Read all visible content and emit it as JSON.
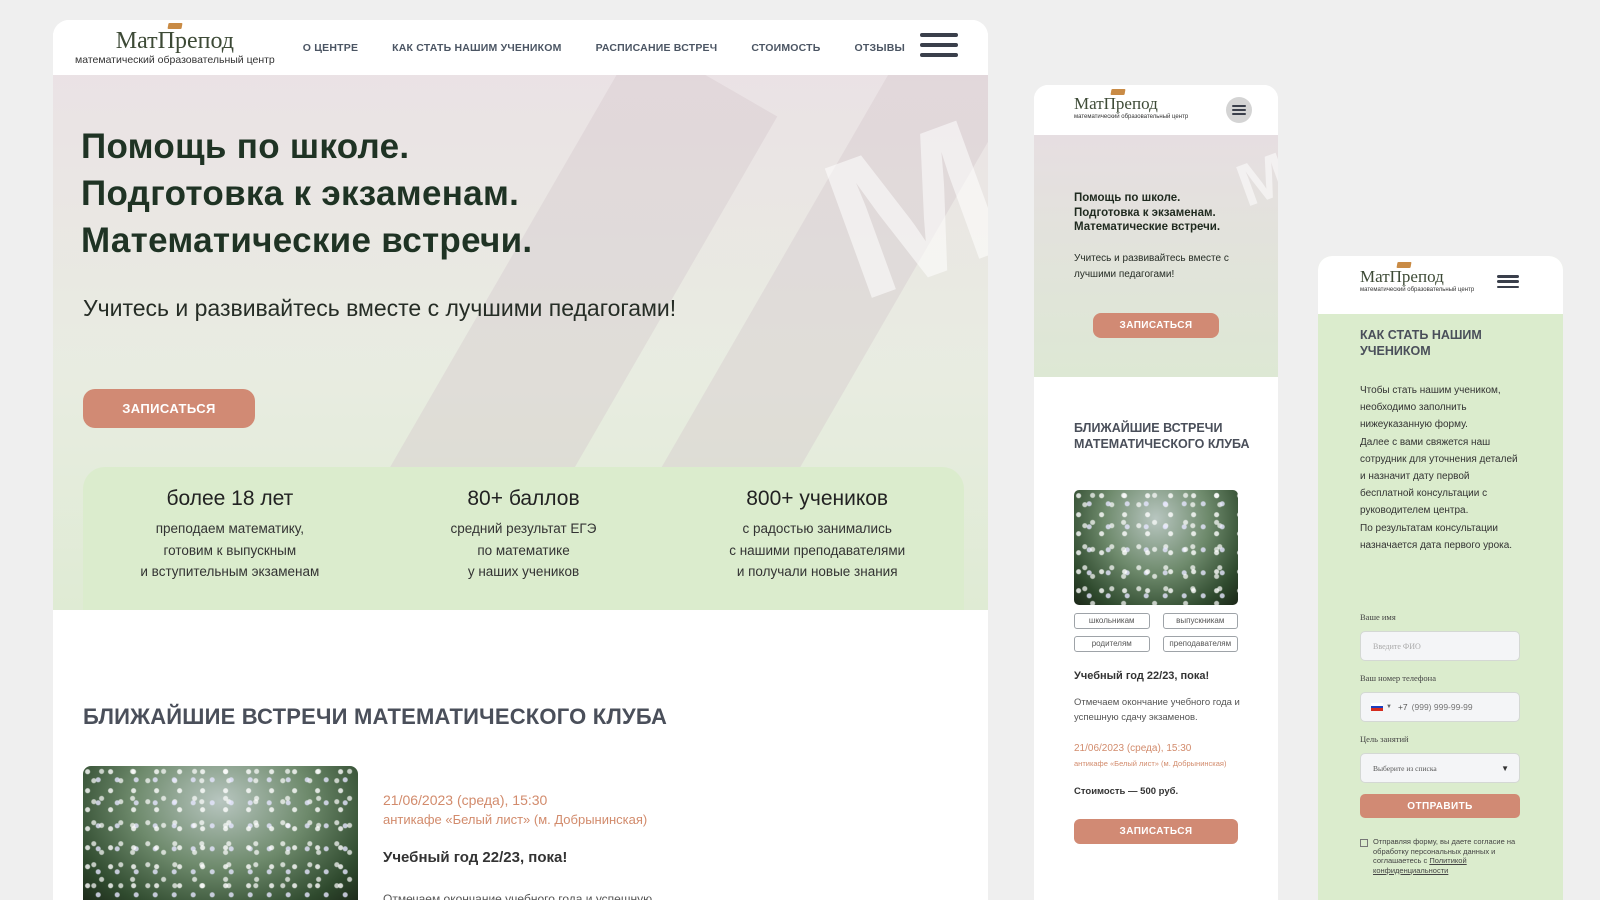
{
  "logo": {
    "name": "МатПрепод",
    "subtitle": "математический образовательный центр"
  },
  "desktop": {
    "nav": [
      {
        "label": "О ЦЕНТРЕ"
      },
      {
        "label": "КАК СТАТЬ НАШИМ УЧЕНИКОМ"
      },
      {
        "label": "РАСПИСАНИЕ ВСТРЕЧ"
      },
      {
        "label": "СТОИМОСТЬ"
      },
      {
        "label": "ОТЗЫВЫ"
      }
    ],
    "hero": {
      "line1": "Помощь по школе.",
      "line2": "Подготовка к экзаменам.",
      "line3": "Математические встречи.",
      "subtitle": "Учитесь и развивайтесь вместе с лучшими педагогами!",
      "cta": "ЗАПИСАТЬСЯ"
    },
    "stats": [
      {
        "big": "более 18 лет",
        "l1": "преподаем математику,",
        "l2": "готовим к выпускным",
        "l3": "и вступительным экзаменам"
      },
      {
        "big": "80+ баллов",
        "l1": "средний результат ЕГЭ",
        "l2": "по математике",
        "l3": "у наших учеников"
      },
      {
        "big": "800+ учеников",
        "l1": "с радостью занимались",
        "l2": "с нашими преподавателями",
        "l3": "и получали новые знания"
      }
    ],
    "meetings": {
      "title": "БЛИЖАЙШИЕ ВСТРЕЧИ МАТЕМАТИЧЕСКОГО КЛУБА",
      "date": "21/06/2023 (среда), 15:30",
      "place": "антикафе «Белый лист» (м. Добрынинская)",
      "event_title": "Учебный год 22/23, пока!",
      "event_desc": "Отмечаем окончание учебного года и успешную"
    }
  },
  "mobile1": {
    "hero": {
      "line1": "Помощь по школе.",
      "line2": "Подготовка к экзаменам.",
      "line3": "Математические встречи.",
      "subtitle": "Учитесь и развивайтесь вместе с лучшими педагогами!",
      "cta": "ЗАПИСАТЬСЯ"
    },
    "meetings": {
      "title": "БЛИЖАЙШИЕ ВСТРЕЧИ МАТЕМАТИЧЕСКОГО КЛУБА",
      "tags": [
        "школьникам",
        "выпускникам",
        "родителям",
        "преподавателям"
      ],
      "event_title": "Учебный год 22/23, пока!",
      "event_desc": "Отмечаем окончание учебного года и успешную сдачу экзаменов.",
      "date": "21/06/2023 (среда), 15:30",
      "place": "антикафе «Белый лист» (м. Добрынинская)",
      "price": "Стоимость — 500 руб.",
      "cta": "ЗАПИСАТЬСЯ"
    }
  },
  "mobile2": {
    "title": "КАК СТАТЬ НАШИМ УЧЕНИКОМ",
    "text": {
      "p1": "Чтобы стать нашим учеником, необходимо заполнить нижеуказанную форму.",
      "p2": "Далее с вами свяжется наш сотрудник для уточнения деталей и назначит дату первой бесплатной консультации с руководителем центра.",
      "p3": "По результатам консультации назначается дата первого урока."
    },
    "form": {
      "name_label": "Ваше имя",
      "name_placeholder": "Введите ФИО",
      "phone_label": "Ваш номер телефона",
      "phone_code": "+7",
      "phone_placeholder": "(999) 999-99-99",
      "goal_label": "Цель занятий",
      "goal_selected": "Выберите из списка",
      "submit": "ОТПРАВИТЬ",
      "consent_text": "Отправляя форму, вы даете согласие на обработку персональных данных и соглашаетесь с",
      "consent_link": "Политикой конфиденциальности"
    }
  },
  "colors": {
    "accent": "#d18a74",
    "mint": "#dbeccd",
    "dark_green": "#1f3324",
    "logo_gold": "#c98b45"
  }
}
